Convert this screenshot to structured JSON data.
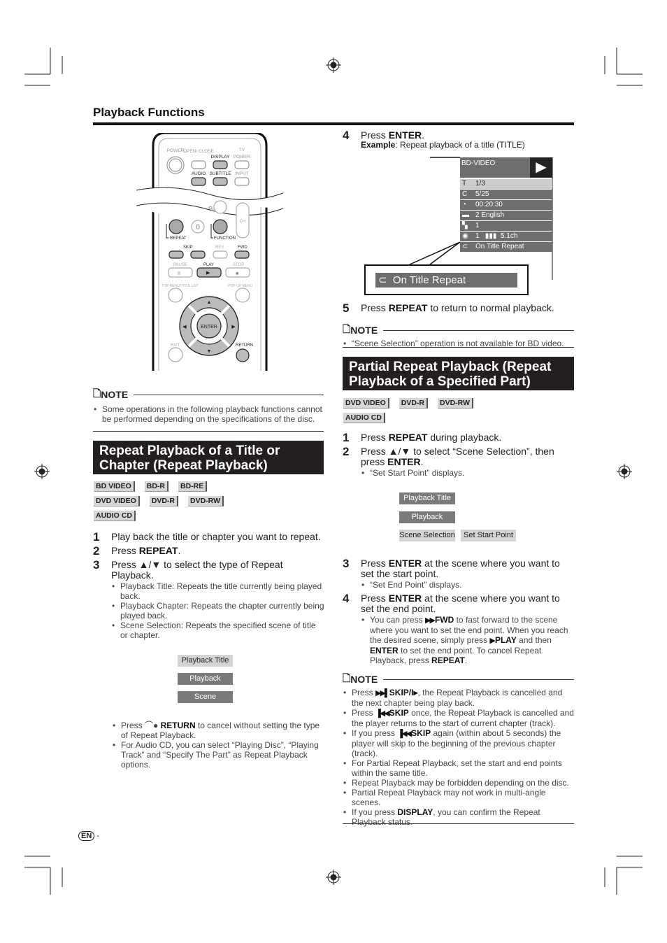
{
  "header": {
    "title": "Playback Functions"
  },
  "remote": {
    "labels": {
      "power": "POWER",
      "open_close": "OPEN/\nCLOSE",
      "display": "DISPLAY",
      "tv": "TV",
      "tv_power": "POWER",
      "audio": "AUDIO",
      "subtitle": "SUBTITLE",
      "input": "INPUT",
      "nine": "9",
      "zero": "0",
      "ch": "CH",
      "repeat": "REPEAT",
      "function": "FUNCTION",
      "skip": "SKIP",
      "rev": "REV",
      "fwd": "FWD",
      "pause": "PAUSE",
      "play": "PLAY",
      "stop": "STOP",
      "top_menu": "TOP MENU/TITLE LIST",
      "popup_menu": "POP-UP MENU",
      "enter": "ENTER",
      "exit": "EXIT",
      "return": "RETURN"
    }
  },
  "left_note": {
    "heading": "NOTE",
    "bullets": [
      "Some operations in the following playback functions cannot be performed depending on the specifications of the disc."
    ]
  },
  "repeat_section": {
    "heading": "Repeat Playback of a Title or Chapter (Repeat Playback)",
    "badges": [
      [
        "BD VIDEO",
        "BD-R",
        "BD-RE"
      ],
      [
        "DVD VIDEO",
        "DVD-R",
        "DVD-RW"
      ],
      [
        "AUDIO CD"
      ]
    ],
    "steps": [
      {
        "num": "1",
        "text": [
          {
            "t": "Play back the title or chapter you want to repeat."
          }
        ]
      },
      {
        "num": "2",
        "text": [
          {
            "t": "Press "
          },
          {
            "t": "REPEAT",
            "b": true
          },
          {
            "t": "."
          }
        ]
      },
      {
        "num": "3",
        "text": [
          {
            "t": "Press ▲/▼ to select the type of Repeat Playback."
          }
        ],
        "bullets": [
          [
            {
              "t": "Playback Title: Repeats the title currently being played back."
            }
          ],
          [
            {
              "t": "Playback Chapter: Repeats the chapter currently being played back."
            }
          ],
          [
            {
              "t": "Scene Selection: Repeats the specified scene of title or chapter."
            }
          ]
        ]
      }
    ],
    "menu": [
      "Playback Title",
      "Playback Chapter",
      "Scene Selection"
    ],
    "after_bullets": [
      [
        {
          "t": "Press "
        },
        {
          "t": "RETURN",
          "b": true,
          "icon": "return-icon"
        },
        {
          "t": " to cancel without setting the type of Repeat Playback."
        }
      ],
      [
        {
          "t": "For Audio CD, you can select “Playing Disc”, “Playing Track” and “Specify The Part” as Repeat Playback options."
        }
      ]
    ]
  },
  "step4": {
    "num": "4",
    "text": [
      {
        "t": "Press "
      },
      {
        "t": "ENTER",
        "b": true
      },
      {
        "t": "."
      }
    ],
    "example": [
      {
        "t": "Example",
        "b": true
      },
      {
        "t": ": Repeat playback of a title (TITLE)"
      }
    ]
  },
  "display_panel": {
    "disc": "BD-VIDEO",
    "rows": [
      {
        "icon": "title-icon",
        "value": "1/3"
      },
      {
        "icon": "chapter-icon",
        "value": "5/25"
      },
      {
        "icon": "clock-icon",
        "value": "00:20:30"
      },
      {
        "icon": "subtitle-icon",
        "value": "2 English"
      },
      {
        "icon": "angle-icon",
        "value": "1"
      },
      {
        "icon": "audio-icon",
        "value": "1   ▮▮▮  5.1ch"
      },
      {
        "icon": "repeat-icon",
        "value": "On Title Repeat"
      }
    ],
    "callout": "On Title Repeat"
  },
  "step5": {
    "num": "5",
    "text": [
      {
        "t": "Press "
      },
      {
        "t": "REPEAT",
        "b": true
      },
      {
        "t": " to return to normal playback."
      }
    ]
  },
  "right_note1": {
    "heading": "NOTE",
    "bullets": [
      [
        {
          "t": "“Scene Selection” operation is not available for BD video."
        }
      ]
    ]
  },
  "partial_section": {
    "heading": "Partial Repeat Playback (Repeat Playback of a Specified Part)",
    "badges": [
      [
        "DVD VIDEO",
        "DVD-R",
        "DVD-RW"
      ],
      [
        "AUDIO CD"
      ]
    ],
    "steps_a": [
      {
        "num": "1",
        "text": [
          {
            "t": "Press "
          },
          {
            "t": "REPEAT",
            "b": true
          },
          {
            "t": " during playback."
          }
        ]
      },
      {
        "num": "2",
        "text": [
          {
            "t": "Press ▲/▼ to select “Scene Selection”, then press "
          },
          {
            "t": "ENTER",
            "b": true
          },
          {
            "t": "."
          }
        ],
        "bullets": [
          [
            {
              "t": "“Set Start Point” displays."
            }
          ]
        ]
      }
    ],
    "menu": [
      "Playback Title",
      "Playback Chapter",
      "Scene Selection"
    ],
    "menu_sub": "Set Start Point",
    "steps_b": [
      {
        "num": "3",
        "text": [
          {
            "t": "Press "
          },
          {
            "t": "ENTER",
            "b": true
          },
          {
            "t": " at the scene where you want to set the start point."
          }
        ],
        "bullets": [
          [
            {
              "t": "“Set End Point” displays."
            }
          ]
        ]
      },
      {
        "num": "4",
        "text": [
          {
            "t": "Press "
          },
          {
            "t": "ENTER",
            "b": true
          },
          {
            "t": " at the scene where you want to set the end point."
          }
        ],
        "bullets": [
          [
            {
              "t": "You can press "
            },
            {
              "t": "▶▶ ",
              "g": true
            },
            {
              "t": "FWD",
              "b": true
            },
            {
              "t": " to fast forward to the scene where you want to set the end point. When you reach the desired scene, simply press "
            },
            {
              "t": "▶ ",
              "g": true
            },
            {
              "t": "PLAY",
              "b": true
            },
            {
              "t": " and then "
            },
            {
              "t": "ENTER",
              "b": true
            },
            {
              "t": " to set the end point. To cancel Repeat Playback, press "
            },
            {
              "t": "REPEAT",
              "b": true
            },
            {
              "t": "."
            }
          ]
        ]
      }
    ]
  },
  "right_note2": {
    "heading": "NOTE",
    "bullets": [
      [
        {
          "t": "Press "
        },
        {
          "t": "▶▶▌ ",
          "g": true
        },
        {
          "t": "SKIP/I▸",
          "b": true
        },
        {
          "t": ", the Repeat Playback is cancelled and the next chapter being play back."
        }
      ],
      [
        {
          "t": "Press "
        },
        {
          "t": "▐◀◀ ",
          "g": true
        },
        {
          "t": "SKIP",
          "b": true
        },
        {
          "t": " once, the Repeat Playback is cancelled and the player returns to the start of current chapter (track)."
        }
      ],
      [
        {
          "t": "If you press "
        },
        {
          "t": "▐◀◀ ",
          "g": true
        },
        {
          "t": "SKIP",
          "b": true
        },
        {
          "t": " again (within about 5 seconds) the player will skip to the beginning of the previous chapter (track)."
        }
      ],
      [
        {
          "t": "For Partial Repeat Playback, set the start and end points within the same title."
        }
      ],
      [
        {
          "t": "Repeat Playback may be forbidden depending on the disc."
        }
      ],
      [
        {
          "t": "Partial Repeat Playback may not work in multi-angle scenes."
        }
      ],
      [
        {
          "t": "If you press "
        },
        {
          "t": "DISPLAY",
          "b": true
        },
        {
          "t": ", you can confirm the Repeat Playback status."
        }
      ]
    ]
  },
  "footer": {
    "lang": "EN",
    "dash": "-"
  },
  "colors": {
    "heading_bg": "#231f20",
    "badge_bg": "#d6d6d6",
    "menu_dark": "#7a7a7a",
    "menu_light": "#d4d4d4",
    "panel": "#6e6e6e"
  }
}
